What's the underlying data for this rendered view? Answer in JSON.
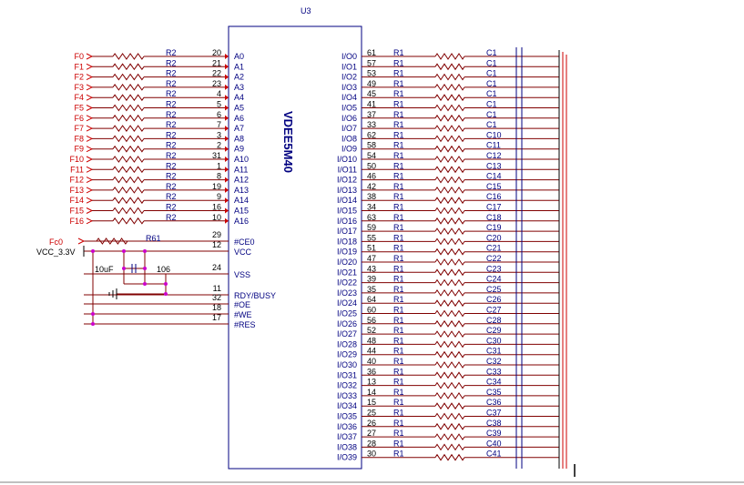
{
  "component": {
    "ref": "U3",
    "part": "VDEE5M40",
    "left_pins": [
      {
        "num": "20",
        "name": "A0"
      },
      {
        "num": "21",
        "name": "A1"
      },
      {
        "num": "22",
        "name": "A2"
      },
      {
        "num": "23",
        "name": "A3"
      },
      {
        "num": "4",
        "name": "A4"
      },
      {
        "num": "5",
        "name": "A5"
      },
      {
        "num": "6",
        "name": "A6"
      },
      {
        "num": "7",
        "name": "A7"
      },
      {
        "num": "3",
        "name": "A8"
      },
      {
        "num": "2",
        "name": "A9"
      },
      {
        "num": "31",
        "name": "A10"
      },
      {
        "num": "1",
        "name": "A11"
      },
      {
        "num": "8",
        "name": "A12"
      },
      {
        "num": "19",
        "name": "A13"
      },
      {
        "num": "9",
        "name": "A14"
      },
      {
        "num": "16",
        "name": "A15"
      },
      {
        "num": "10",
        "name": "A16"
      }
    ],
    "ctrl_pins": [
      {
        "num": "29",
        "name": "#CE0"
      },
      {
        "num": "12",
        "name": "VCC"
      },
      {
        "num": "24",
        "name": "VSS"
      },
      {
        "num": "11",
        "name": "RDY/BUSY"
      },
      {
        "num": "32",
        "name": "#OE"
      },
      {
        "num": "18",
        "name": "#WE"
      },
      {
        "num": "17",
        "name": "#RES"
      }
    ],
    "right_pins": [
      {
        "num": "61",
        "name": "I/O0"
      },
      {
        "num": "57",
        "name": "I/O1"
      },
      {
        "num": "53",
        "name": "I/O2"
      },
      {
        "num": "49",
        "name": "I/O3"
      },
      {
        "num": "45",
        "name": "I/O4"
      },
      {
        "num": "41",
        "name": "I/O5"
      },
      {
        "num": "37",
        "name": "I/O6"
      },
      {
        "num": "33",
        "name": "I/O7"
      },
      {
        "num": "62",
        "name": "I/O8"
      },
      {
        "num": "58",
        "name": "I/O9"
      },
      {
        "num": "54",
        "name": "I/O10"
      },
      {
        "num": "50",
        "name": "I/O11"
      },
      {
        "num": "46",
        "name": "I/O12"
      },
      {
        "num": "42",
        "name": "I/O13"
      },
      {
        "num": "38",
        "name": "I/O14"
      },
      {
        "num": "34",
        "name": "I/O15"
      },
      {
        "num": "63",
        "name": "I/O16"
      },
      {
        "num": "59",
        "name": "I/O17"
      },
      {
        "num": "55",
        "name": "I/O18"
      },
      {
        "num": "51",
        "name": "I/O19"
      },
      {
        "num": "47",
        "name": "I/O20"
      },
      {
        "num": "43",
        "name": "I/O21"
      },
      {
        "num": "39",
        "name": "I/O22"
      },
      {
        "num": "35",
        "name": "I/O23"
      },
      {
        "num": "64",
        "name": "I/O24"
      },
      {
        "num": "60",
        "name": "I/O25"
      },
      {
        "num": "56",
        "name": "I/O26"
      },
      {
        "num": "52",
        "name": "I/O27"
      },
      {
        "num": "48",
        "name": "I/O28"
      },
      {
        "num": "44",
        "name": "I/O29"
      },
      {
        "num": "40",
        "name": "I/O30"
      },
      {
        "num": "36",
        "name": "I/O31"
      },
      {
        "num": "13",
        "name": "I/O32"
      },
      {
        "num": "14",
        "name": "I/O33"
      },
      {
        "num": "15",
        "name": "I/O34"
      },
      {
        "num": "25",
        "name": "I/O35"
      },
      {
        "num": "26",
        "name": "I/O36"
      },
      {
        "num": "27",
        "name": "I/O37"
      },
      {
        "num": "28",
        "name": "I/O38"
      },
      {
        "num": "30",
        "name": "I/O39"
      }
    ]
  },
  "inputs": {
    "signals": [
      "F0",
      "F1",
      "F2",
      "F3",
      "F4",
      "F5",
      "F6",
      "F7",
      "F8",
      "F9",
      "F10",
      "F11",
      "F12",
      "F13",
      "F14",
      "F15",
      "F16"
    ],
    "resistor_label": "R2"
  },
  "outputs": {
    "resistor_label": "R1",
    "net_labels": [
      "C1",
      "C1",
      "C1",
      "C1",
      "C1",
      "C1",
      "C1",
      "C1",
      "C10",
      "C11",
      "C12",
      "C13",
      "C14",
      "C15",
      "C16",
      "C17",
      "C18",
      "C19",
      "C20",
      "C21",
      "C22",
      "C23",
      "C24",
      "C25",
      "C26",
      "C27",
      "C28",
      "C29",
      "C30",
      "C31",
      "C32",
      "C33",
      "C34",
      "C35",
      "C36",
      "C37",
      "C38",
      "C39",
      "C40",
      "C41"
    ]
  },
  "power": {
    "fc0_label": "Fc0",
    "r61_label": "R61",
    "vcc_label": "VCC_3.3V",
    "cap1_label": "10uF",
    "cap2_label": "106"
  },
  "colors": {
    "wire": "#800000",
    "body": "#000080",
    "signal_text": "#cc0000",
    "junction": "#cc00cc",
    "pin_arrow": "#cc0000"
  }
}
